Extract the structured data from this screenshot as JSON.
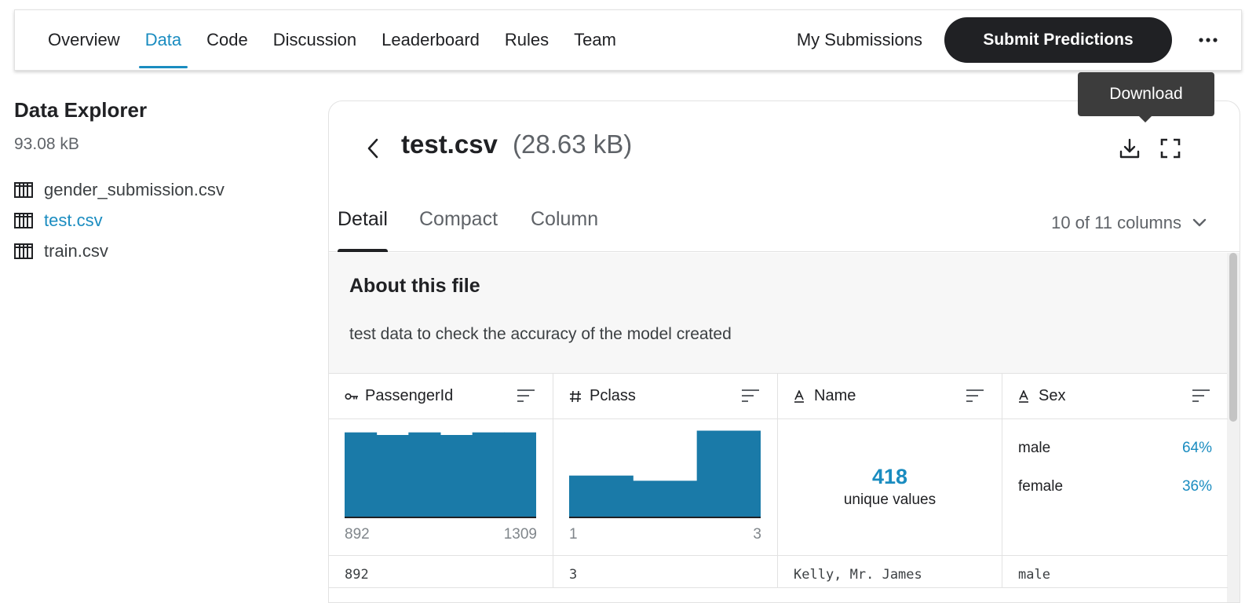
{
  "nav": {
    "tabs": [
      {
        "label": "Overview",
        "active": false
      },
      {
        "label": "Data",
        "active": true
      },
      {
        "label": "Code",
        "active": false
      },
      {
        "label": "Discussion",
        "active": false
      },
      {
        "label": "Leaderboard",
        "active": false
      },
      {
        "label": "Rules",
        "active": false
      },
      {
        "label": "Team",
        "active": false
      }
    ],
    "my_submissions": "My Submissions",
    "submit_button": "Submit Predictions",
    "more_icon": "more-horizontal-icon"
  },
  "sidebar": {
    "title": "Data Explorer",
    "size": "93.08 kB",
    "files": [
      {
        "name": "gender_submission.csv",
        "active": false
      },
      {
        "name": "test.csv",
        "active": true
      },
      {
        "name": "train.csv",
        "active": false
      }
    ]
  },
  "file": {
    "name": "test.csv",
    "size": "(28.63 kB)",
    "tooltip": "Download"
  },
  "view_tabs": {
    "items": [
      "Detail",
      "Compact",
      "Column"
    ],
    "active": "Detail",
    "column_selector": "10 of 11 columns"
  },
  "about": {
    "title": "About this file",
    "description": "test data to check the accuracy of the model created"
  },
  "columns": [
    {
      "name": "PassengerId",
      "type_icon": "key-icon",
      "summary": {
        "kind": "histogram",
        "bars": [
          0.98,
          0.95,
          0.98,
          0.95,
          0.98,
          0.98
        ],
        "min": "892",
        "max": "1309"
      }
    },
    {
      "name": "Pclass",
      "type_icon": "hash-icon",
      "summary": {
        "kind": "histogram",
        "bars": [
          0.48,
          0.42,
          1.0
        ],
        "min": "1",
        "max": "3"
      }
    },
    {
      "name": "Name",
      "type_icon": "text-icon",
      "summary": {
        "kind": "unique",
        "count": "418",
        "label": "unique values"
      }
    },
    {
      "name": "Sex",
      "type_icon": "text-icon",
      "summary": {
        "kind": "categorical",
        "items": [
          {
            "label": "male",
            "pct": "64%"
          },
          {
            "label": "female",
            "pct": "36%"
          }
        ]
      }
    }
  ],
  "first_row": [
    "892",
    "3",
    "Kelly, Mr. James",
    "male"
  ],
  "colors": {
    "accent": "#1a8cc0",
    "bar": "#1a7aa8",
    "dark": "#202124"
  }
}
